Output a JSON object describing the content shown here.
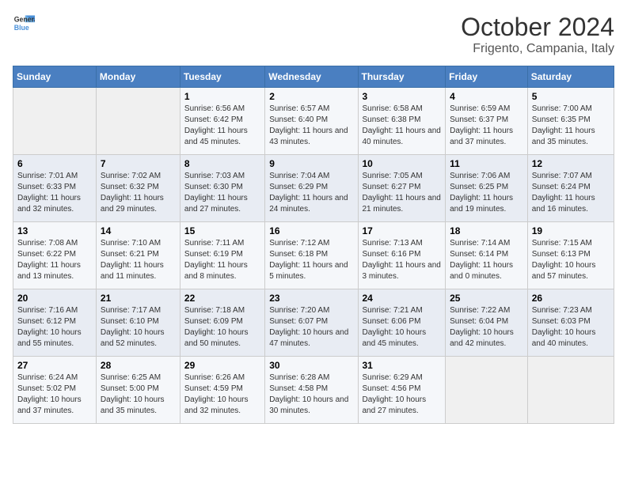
{
  "logo": {
    "line1": "General",
    "line2": "Blue"
  },
  "title": "October 2024",
  "subtitle": "Frigento, Campania, Italy",
  "weekdays": [
    "Sunday",
    "Monday",
    "Tuesday",
    "Wednesday",
    "Thursday",
    "Friday",
    "Saturday"
  ],
  "weeks": [
    [
      {
        "day": "",
        "sunrise": "",
        "sunset": "",
        "daylight": ""
      },
      {
        "day": "",
        "sunrise": "",
        "sunset": "",
        "daylight": ""
      },
      {
        "day": "1",
        "sunrise": "Sunrise: 6:56 AM",
        "sunset": "Sunset: 6:42 PM",
        "daylight": "Daylight: 11 hours and 45 minutes."
      },
      {
        "day": "2",
        "sunrise": "Sunrise: 6:57 AM",
        "sunset": "Sunset: 6:40 PM",
        "daylight": "Daylight: 11 hours and 43 minutes."
      },
      {
        "day": "3",
        "sunrise": "Sunrise: 6:58 AM",
        "sunset": "Sunset: 6:38 PM",
        "daylight": "Daylight: 11 hours and 40 minutes."
      },
      {
        "day": "4",
        "sunrise": "Sunrise: 6:59 AM",
        "sunset": "Sunset: 6:37 PM",
        "daylight": "Daylight: 11 hours and 37 minutes."
      },
      {
        "day": "5",
        "sunrise": "Sunrise: 7:00 AM",
        "sunset": "Sunset: 6:35 PM",
        "daylight": "Daylight: 11 hours and 35 minutes."
      }
    ],
    [
      {
        "day": "6",
        "sunrise": "Sunrise: 7:01 AM",
        "sunset": "Sunset: 6:33 PM",
        "daylight": "Daylight: 11 hours and 32 minutes."
      },
      {
        "day": "7",
        "sunrise": "Sunrise: 7:02 AM",
        "sunset": "Sunset: 6:32 PM",
        "daylight": "Daylight: 11 hours and 29 minutes."
      },
      {
        "day": "8",
        "sunrise": "Sunrise: 7:03 AM",
        "sunset": "Sunset: 6:30 PM",
        "daylight": "Daylight: 11 hours and 27 minutes."
      },
      {
        "day": "9",
        "sunrise": "Sunrise: 7:04 AM",
        "sunset": "Sunset: 6:29 PM",
        "daylight": "Daylight: 11 hours and 24 minutes."
      },
      {
        "day": "10",
        "sunrise": "Sunrise: 7:05 AM",
        "sunset": "Sunset: 6:27 PM",
        "daylight": "Daylight: 11 hours and 21 minutes."
      },
      {
        "day": "11",
        "sunrise": "Sunrise: 7:06 AM",
        "sunset": "Sunset: 6:25 PM",
        "daylight": "Daylight: 11 hours and 19 minutes."
      },
      {
        "day": "12",
        "sunrise": "Sunrise: 7:07 AM",
        "sunset": "Sunset: 6:24 PM",
        "daylight": "Daylight: 11 hours and 16 minutes."
      }
    ],
    [
      {
        "day": "13",
        "sunrise": "Sunrise: 7:08 AM",
        "sunset": "Sunset: 6:22 PM",
        "daylight": "Daylight: 11 hours and 13 minutes."
      },
      {
        "day": "14",
        "sunrise": "Sunrise: 7:10 AM",
        "sunset": "Sunset: 6:21 PM",
        "daylight": "Daylight: 11 hours and 11 minutes."
      },
      {
        "day": "15",
        "sunrise": "Sunrise: 7:11 AM",
        "sunset": "Sunset: 6:19 PM",
        "daylight": "Daylight: 11 hours and 8 minutes."
      },
      {
        "day": "16",
        "sunrise": "Sunrise: 7:12 AM",
        "sunset": "Sunset: 6:18 PM",
        "daylight": "Daylight: 11 hours and 5 minutes."
      },
      {
        "day": "17",
        "sunrise": "Sunrise: 7:13 AM",
        "sunset": "Sunset: 6:16 PM",
        "daylight": "Daylight: 11 hours and 3 minutes."
      },
      {
        "day": "18",
        "sunrise": "Sunrise: 7:14 AM",
        "sunset": "Sunset: 6:14 PM",
        "daylight": "Daylight: 11 hours and 0 minutes."
      },
      {
        "day": "19",
        "sunrise": "Sunrise: 7:15 AM",
        "sunset": "Sunset: 6:13 PM",
        "daylight": "Daylight: 10 hours and 57 minutes."
      }
    ],
    [
      {
        "day": "20",
        "sunrise": "Sunrise: 7:16 AM",
        "sunset": "Sunset: 6:12 PM",
        "daylight": "Daylight: 10 hours and 55 minutes."
      },
      {
        "day": "21",
        "sunrise": "Sunrise: 7:17 AM",
        "sunset": "Sunset: 6:10 PM",
        "daylight": "Daylight: 10 hours and 52 minutes."
      },
      {
        "day": "22",
        "sunrise": "Sunrise: 7:18 AM",
        "sunset": "Sunset: 6:09 PM",
        "daylight": "Daylight: 10 hours and 50 minutes."
      },
      {
        "day": "23",
        "sunrise": "Sunrise: 7:20 AM",
        "sunset": "Sunset: 6:07 PM",
        "daylight": "Daylight: 10 hours and 47 minutes."
      },
      {
        "day": "24",
        "sunrise": "Sunrise: 7:21 AM",
        "sunset": "Sunset: 6:06 PM",
        "daylight": "Daylight: 10 hours and 45 minutes."
      },
      {
        "day": "25",
        "sunrise": "Sunrise: 7:22 AM",
        "sunset": "Sunset: 6:04 PM",
        "daylight": "Daylight: 10 hours and 42 minutes."
      },
      {
        "day": "26",
        "sunrise": "Sunrise: 7:23 AM",
        "sunset": "Sunset: 6:03 PM",
        "daylight": "Daylight: 10 hours and 40 minutes."
      }
    ],
    [
      {
        "day": "27",
        "sunrise": "Sunrise: 6:24 AM",
        "sunset": "Sunset: 5:02 PM",
        "daylight": "Daylight: 10 hours and 37 minutes."
      },
      {
        "day": "28",
        "sunrise": "Sunrise: 6:25 AM",
        "sunset": "Sunset: 5:00 PM",
        "daylight": "Daylight: 10 hours and 35 minutes."
      },
      {
        "day": "29",
        "sunrise": "Sunrise: 6:26 AM",
        "sunset": "Sunset: 4:59 PM",
        "daylight": "Daylight: 10 hours and 32 minutes."
      },
      {
        "day": "30",
        "sunrise": "Sunrise: 6:28 AM",
        "sunset": "Sunset: 4:58 PM",
        "daylight": "Daylight: 10 hours and 30 minutes."
      },
      {
        "day": "31",
        "sunrise": "Sunrise: 6:29 AM",
        "sunset": "Sunset: 4:56 PM",
        "daylight": "Daylight: 10 hours and 27 minutes."
      },
      {
        "day": "",
        "sunrise": "",
        "sunset": "",
        "daylight": ""
      },
      {
        "day": "",
        "sunrise": "",
        "sunset": "",
        "daylight": ""
      }
    ]
  ]
}
